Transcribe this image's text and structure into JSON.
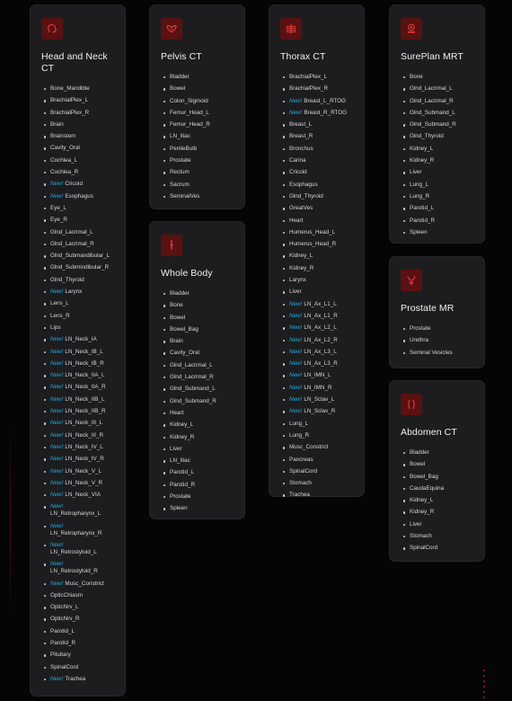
{
  "cards": [
    {
      "id": "card-head",
      "name": "head-and-neck-ct",
      "icon": "head-icon",
      "title": "Head and Neck CT",
      "items": [
        {
          "label": "Bone_Mandible"
        },
        {
          "label": "BrachialPlex_L"
        },
        {
          "label": "BrachialPlex_R"
        },
        {
          "label": "Brain"
        },
        {
          "label": "Brainstem"
        },
        {
          "label": "Cavity_Oral"
        },
        {
          "label": "Cochlea_L"
        },
        {
          "label": "Cochlea_R"
        },
        {
          "label": "Cricoid",
          "new": true
        },
        {
          "label": "Esophagus",
          "new": true
        },
        {
          "label": "Eye_L"
        },
        {
          "label": "Eye_R"
        },
        {
          "label": "Glnd_Lacrimal_L"
        },
        {
          "label": "Glnd_Lacrimal_R"
        },
        {
          "label": "Glnd_Submandibular_L"
        },
        {
          "label": "Glnd_Submindibular_R"
        },
        {
          "label": "Glnd_Thyroid"
        },
        {
          "label": "Larynx",
          "new": true
        },
        {
          "label": "Lens_L"
        },
        {
          "label": "Lens_R"
        },
        {
          "label": "Lips"
        },
        {
          "label": "LN_Neck_IA",
          "new": true
        },
        {
          "label": "LN_Neck_IB_L",
          "new": true
        },
        {
          "label": "LN_Neck_IB_R",
          "new": true
        },
        {
          "label": "LN_Neck_IIA_L",
          "new": true
        },
        {
          "label": "LN_Neck_IIA_R",
          "new": true
        },
        {
          "label": "LN_Neck_IIB_L",
          "new": true
        },
        {
          "label": "LN_Neck_IIB_R",
          "new": true
        },
        {
          "label": "LN_Neck_III_L",
          "new": true
        },
        {
          "label": "LN_Neck_III_R",
          "new": true
        },
        {
          "label": "LN_Neck_IV_L",
          "new": true
        },
        {
          "label": "LN_Neck_IV_R",
          "new": true
        },
        {
          "label": "LN_Neck_V_L",
          "new": true
        },
        {
          "label": "LN_Neck_V_R",
          "new": true
        },
        {
          "label": "LN_Neck_VIA",
          "new": true
        },
        {
          "label": "LN_Retropharynx_L",
          "new": true,
          "wrap": true
        },
        {
          "label": "LN_Retropharynx_R",
          "new": true,
          "wrap": true
        },
        {
          "label": "LN_Retrostyloid_L",
          "new": true,
          "wrap": true
        },
        {
          "label": "LN_Retrostyloid_R",
          "new": true,
          "wrap": true
        },
        {
          "label": "Musc_Constrict",
          "new": true
        },
        {
          "label": "OpticChiasm"
        },
        {
          "label": "OpticNrv_L"
        },
        {
          "label": "OpticNrv_R"
        },
        {
          "label": "Parotid_L"
        },
        {
          "label": "Parotid_R"
        },
        {
          "label": "Pituitary"
        },
        {
          "label": "SpinalCord"
        },
        {
          "label": "Trachea",
          "new": true
        }
      ]
    },
    {
      "id": "card-pelvis",
      "name": "pelvis-ct",
      "icon": "pelvis-icon",
      "title": "Pelvis CT",
      "items": [
        {
          "label": "Bladder"
        },
        {
          "label": "Bowel"
        },
        {
          "label": "Colon_Sigmoid"
        },
        {
          "label": "Femur_Head_L"
        },
        {
          "label": "Femur_Head_R"
        },
        {
          "label": "LN_Iliac"
        },
        {
          "label": "PenileBulb"
        },
        {
          "label": "Prostate"
        },
        {
          "label": "Rectum"
        },
        {
          "label": "Sacrum"
        },
        {
          "label": "SeminalVes"
        }
      ]
    },
    {
      "id": "card-whole",
      "name": "whole-body",
      "icon": "body-icon",
      "title": "Whole Body",
      "items": [
        {
          "label": "Bladder"
        },
        {
          "label": "Bone"
        },
        {
          "label": "Bowel"
        },
        {
          "label": "Bowel_Bag"
        },
        {
          "label": "Brain"
        },
        {
          "label": "Cavity_Oral"
        },
        {
          "label": "Glnd_Lacrimal_L"
        },
        {
          "label": "Glnd_Lacrimal_R"
        },
        {
          "label": "Glnd_Submand_L"
        },
        {
          "label": "Glnd_Submand_R"
        },
        {
          "label": "Heart"
        },
        {
          "label": "Kidney_L"
        },
        {
          "label": "Kidney_R"
        },
        {
          "label": "Liver"
        },
        {
          "label": "LN_Iliac"
        },
        {
          "label": "Parotid_L"
        },
        {
          "label": "Parotid_R"
        },
        {
          "label": "Prostate"
        },
        {
          "label": "Spleen"
        }
      ]
    },
    {
      "id": "card-thorax",
      "name": "thorax-ct",
      "icon": "ribcage-icon",
      "title": "Thorax CT",
      "items": [
        {
          "label": "BrachialPlex_L"
        },
        {
          "label": "BrachialPlex_R"
        },
        {
          "label": "Breast_L_RTOG",
          "new": true
        },
        {
          "label": "Breast_R_RTOG",
          "new": true
        },
        {
          "label": "Breast_L"
        },
        {
          "label": "Breast_R"
        },
        {
          "label": "Bronchus"
        },
        {
          "label": "Carina"
        },
        {
          "label": "Cricoid"
        },
        {
          "label": "Esophagus"
        },
        {
          "label": "Glnd_Thyroid"
        },
        {
          "label": "GreatVes"
        },
        {
          "label": "Heart"
        },
        {
          "label": "Humerus_Head_L"
        },
        {
          "label": "Humerus_Head_R"
        },
        {
          "label": "Kidney_L"
        },
        {
          "label": "Kidney_R"
        },
        {
          "label": "Larynx"
        },
        {
          "label": "Liver"
        },
        {
          "label": "LN_Ax_L1_L",
          "new": true
        },
        {
          "label": "LN_Ax_L1_R",
          "new": true
        },
        {
          "label": "LN_Ax_L2_L",
          "new": true
        },
        {
          "label": "LN_Ax_L2_R",
          "new": true
        },
        {
          "label": "LN_Ax_L3_L",
          "new": true
        },
        {
          "label": "LN_Ax_L3_R",
          "new": true
        },
        {
          "label": "LN_IMN_L",
          "new": true
        },
        {
          "label": "LN_IMN_R",
          "new": true
        },
        {
          "label": "LN_Sclav_L",
          "new": true
        },
        {
          "label": "LN_Sclav_R",
          "new": true
        },
        {
          "label": "Lung_L"
        },
        {
          "label": "Lung_R"
        },
        {
          "label": "Musc_Constrict"
        },
        {
          "label": "Pancreas"
        },
        {
          "label": "SpinalCord"
        },
        {
          "label": "Stomach"
        },
        {
          "label": "Trachea"
        }
      ]
    },
    {
      "id": "card-sureplan",
      "name": "sureplan-mrt",
      "icon": "scanner-icon",
      "title": "SurePlan MRT",
      "items": [
        {
          "label": "Bone"
        },
        {
          "label": "Glnd_Lacrimal_L"
        },
        {
          "label": "Glnd_Lacrimal_R"
        },
        {
          "label": "Glnd_Submand_L"
        },
        {
          "label": "Glnd_Submand_R"
        },
        {
          "label": "Glnd_Thyroid"
        },
        {
          "label": "Kidney_L"
        },
        {
          "label": "Kidney_R"
        },
        {
          "label": "Liver"
        },
        {
          "label": "Lung_L"
        },
        {
          "label": "Lung_R"
        },
        {
          "label": "Parotid_L"
        },
        {
          "label": "Parotid_R"
        },
        {
          "label": "Spleen"
        }
      ]
    },
    {
      "id": "card-prostate",
      "name": "prostate-mr",
      "icon": "prostate-icon",
      "title": "Prostate MR",
      "items": [
        {
          "label": "Prostate"
        },
        {
          "label": "Urethra"
        },
        {
          "label": "Seminal Vesicles"
        }
      ]
    },
    {
      "id": "card-abdomen",
      "name": "abdomen-ct",
      "icon": "abdomen-icon",
      "title": "Abdomen CT",
      "items": [
        {
          "label": "Bladder"
        },
        {
          "label": "Bowel"
        },
        {
          "label": "Bowel_Bag"
        },
        {
          "label": "CaudaEquina"
        },
        {
          "label": "Kidney_L"
        },
        {
          "label": "Kidney_R"
        },
        {
          "label": "Liver"
        },
        {
          "label": "Stomach"
        },
        {
          "label": "SpinalCord"
        }
      ]
    }
  ],
  "new_label": "New!",
  "colors": {
    "card_bg": "#1d1d1f",
    "icon_bg": "#5a1111",
    "icon_fg": "#e23b3b",
    "new_tag": "#1fa9de",
    "title": "#f1f1f1",
    "item": "#d6d6d6"
  }
}
